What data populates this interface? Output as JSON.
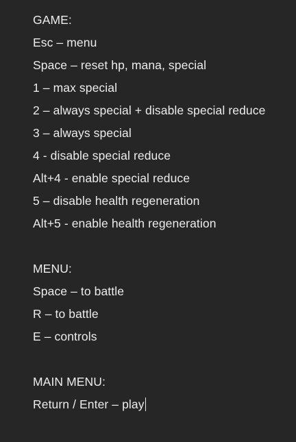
{
  "sections": {
    "game": {
      "heading": "GAME:",
      "lines": [
        "Esc – menu",
        "Space – reset hp, mana, special",
        "1 – max special",
        "2 – always special + disable special reduce",
        "3 – always special",
        "4 - disable special reduce",
        "Alt+4 - enable special reduce",
        "5 – disable health regeneration",
        "Alt+5 - enable health regeneration"
      ]
    },
    "menu": {
      "heading": "MENU:",
      "lines": [
        "Space – to battle",
        "R – to battle",
        "E – controls"
      ]
    },
    "main_menu": {
      "heading": "MAIN MENU:",
      "lines": [
        "Return / Enter – play"
      ]
    }
  },
  "colors": {
    "background": "#262626",
    "text": "#ececec"
  }
}
